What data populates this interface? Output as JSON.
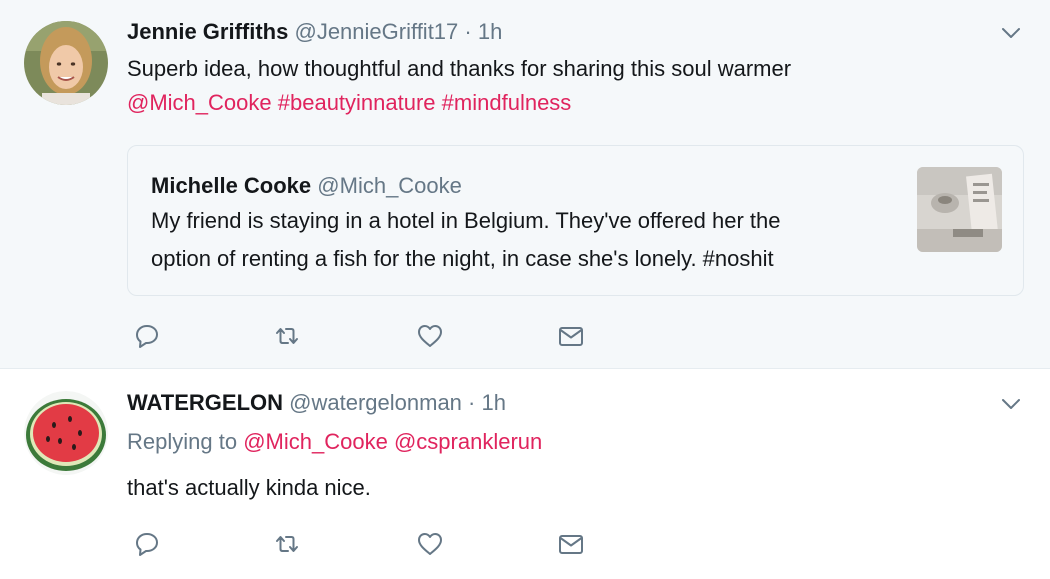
{
  "tweets": [
    {
      "name": "Jennie Griffiths",
      "handle": "@JennieGriffit17",
      "separator": "·",
      "time": "1h",
      "text_line1": "Superb idea, how thoughtful and thanks for sharing this soul warmer",
      "mentions": [
        "@Mich_Cooke",
        "#beautyinnature",
        "#mindfulness"
      ],
      "quote": {
        "name": "Michelle Cooke",
        "handle": "@Mich_Cooke",
        "line1": "My friend is staying in a hotel in Belgium. They've offered her the",
        "line2": "option of renting a fish for the night, in case she's lonely. #noshit"
      }
    },
    {
      "name": "WATERGELON",
      "handle": "@watergelonman",
      "separator": "·",
      "time": "1h",
      "replying_label": "Replying to",
      "replying_to": [
        "@Mich_Cooke",
        "@cspranklerun"
      ],
      "text": "that's actually kinda nice."
    }
  ],
  "icons": {
    "reply": "reply-icon",
    "retweet": "retweet-icon",
    "like": "heart-icon",
    "dm": "envelope-icon",
    "caret": "chevron-down-icon"
  },
  "colors": {
    "link": "#e0245e",
    "secondary": "#657786",
    "icon": "#657786",
    "highlight_bg": "#f5f8fa"
  }
}
